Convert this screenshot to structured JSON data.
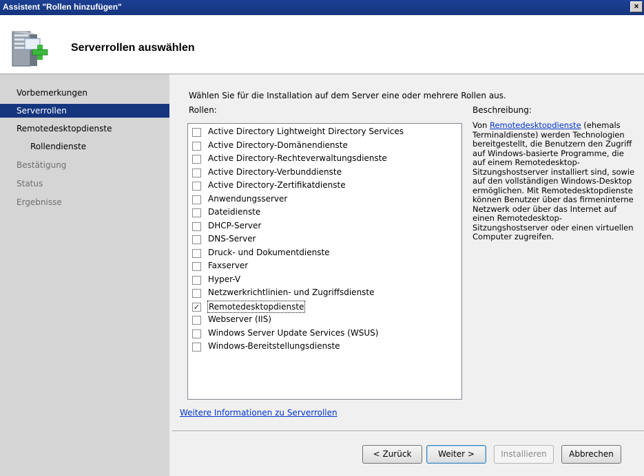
{
  "window": {
    "title": "Assistent \"Rollen hinzufügen\"",
    "close_glyph": "×"
  },
  "header": {
    "title": "Serverrollen auswählen",
    "icon": "server-add-icon"
  },
  "sidebar": {
    "items": [
      {
        "label": "Vorbemerkungen",
        "state": "normal"
      },
      {
        "label": "Serverrollen",
        "state": "selected"
      },
      {
        "label": "Remotedesktopdienste",
        "state": "normal"
      },
      {
        "label": "Rollendienste",
        "state": "sub"
      },
      {
        "label": "Bestätigung",
        "state": "disabled"
      },
      {
        "label": "Status",
        "state": "disabled"
      },
      {
        "label": "Ergebnisse",
        "state": "disabled"
      }
    ]
  },
  "main": {
    "instruction": "Wählen Sie für die Installation auf dem Server eine oder mehrere Rollen aus.",
    "roles_label": "Rollen:",
    "description_label": "Beschreibung:",
    "roles": [
      {
        "label": "Active Directory Lightweight Directory Services",
        "checked": false
      },
      {
        "label": "Active Directory-Domänendienste",
        "checked": false
      },
      {
        "label": "Active Directory-Rechteverwaltungsdienste",
        "checked": false
      },
      {
        "label": "Active Directory-Verbunddienste",
        "checked": false
      },
      {
        "label": "Active Directory-Zertifikatdienste",
        "checked": false
      },
      {
        "label": "Anwendungsserver",
        "checked": false
      },
      {
        "label": "Dateidienste",
        "checked": false
      },
      {
        "label": "DHCP-Server",
        "checked": false
      },
      {
        "label": "DNS-Server",
        "checked": false
      },
      {
        "label": "Druck- und Dokumentdienste",
        "checked": false
      },
      {
        "label": "Faxserver",
        "checked": false
      },
      {
        "label": "Hyper-V",
        "checked": false
      },
      {
        "label": "Netzwerkrichtlinien- und Zugriffsdienste",
        "checked": false
      },
      {
        "label": "Remotedesktopdienste",
        "checked": true
      },
      {
        "label": "Webserver (IIS)",
        "checked": false
      },
      {
        "label": "Windows Server Update Services (WSUS)",
        "checked": false
      },
      {
        "label": "Windows-Bereitstellungsdienste",
        "checked": false
      }
    ],
    "description": {
      "prefix": "Von ",
      "link": "Remotedesktopdienste",
      "text": " (ehemals Terminaldienste) werden Technologien bereitgestellt, die Benutzern den Zugriff auf Windows-basierte Programme, die auf einem Remotedesktop-Sitzungshostserver installiert sind, sowie auf den vollständigen Windows-Desktop ermöglichen. Mit Remotedesktopdienste können Benutzer über das firmeninterne Netzwerk oder über das Internet auf einen Remotedesktop-Sitzungshostserver oder einen virtuellen Computer zugreifen."
    },
    "more_info_link": "Weitere Informationen zu Serverrollen"
  },
  "buttons": {
    "back": "< Zurück",
    "next": "Weiter >",
    "install": "Installieren",
    "cancel": "Abbrechen"
  },
  "colors": {
    "titlebar": "#15357e",
    "selected_nav": "#15357e",
    "sidebar_bg": "#d5d5d5",
    "link": "#0033cc"
  }
}
